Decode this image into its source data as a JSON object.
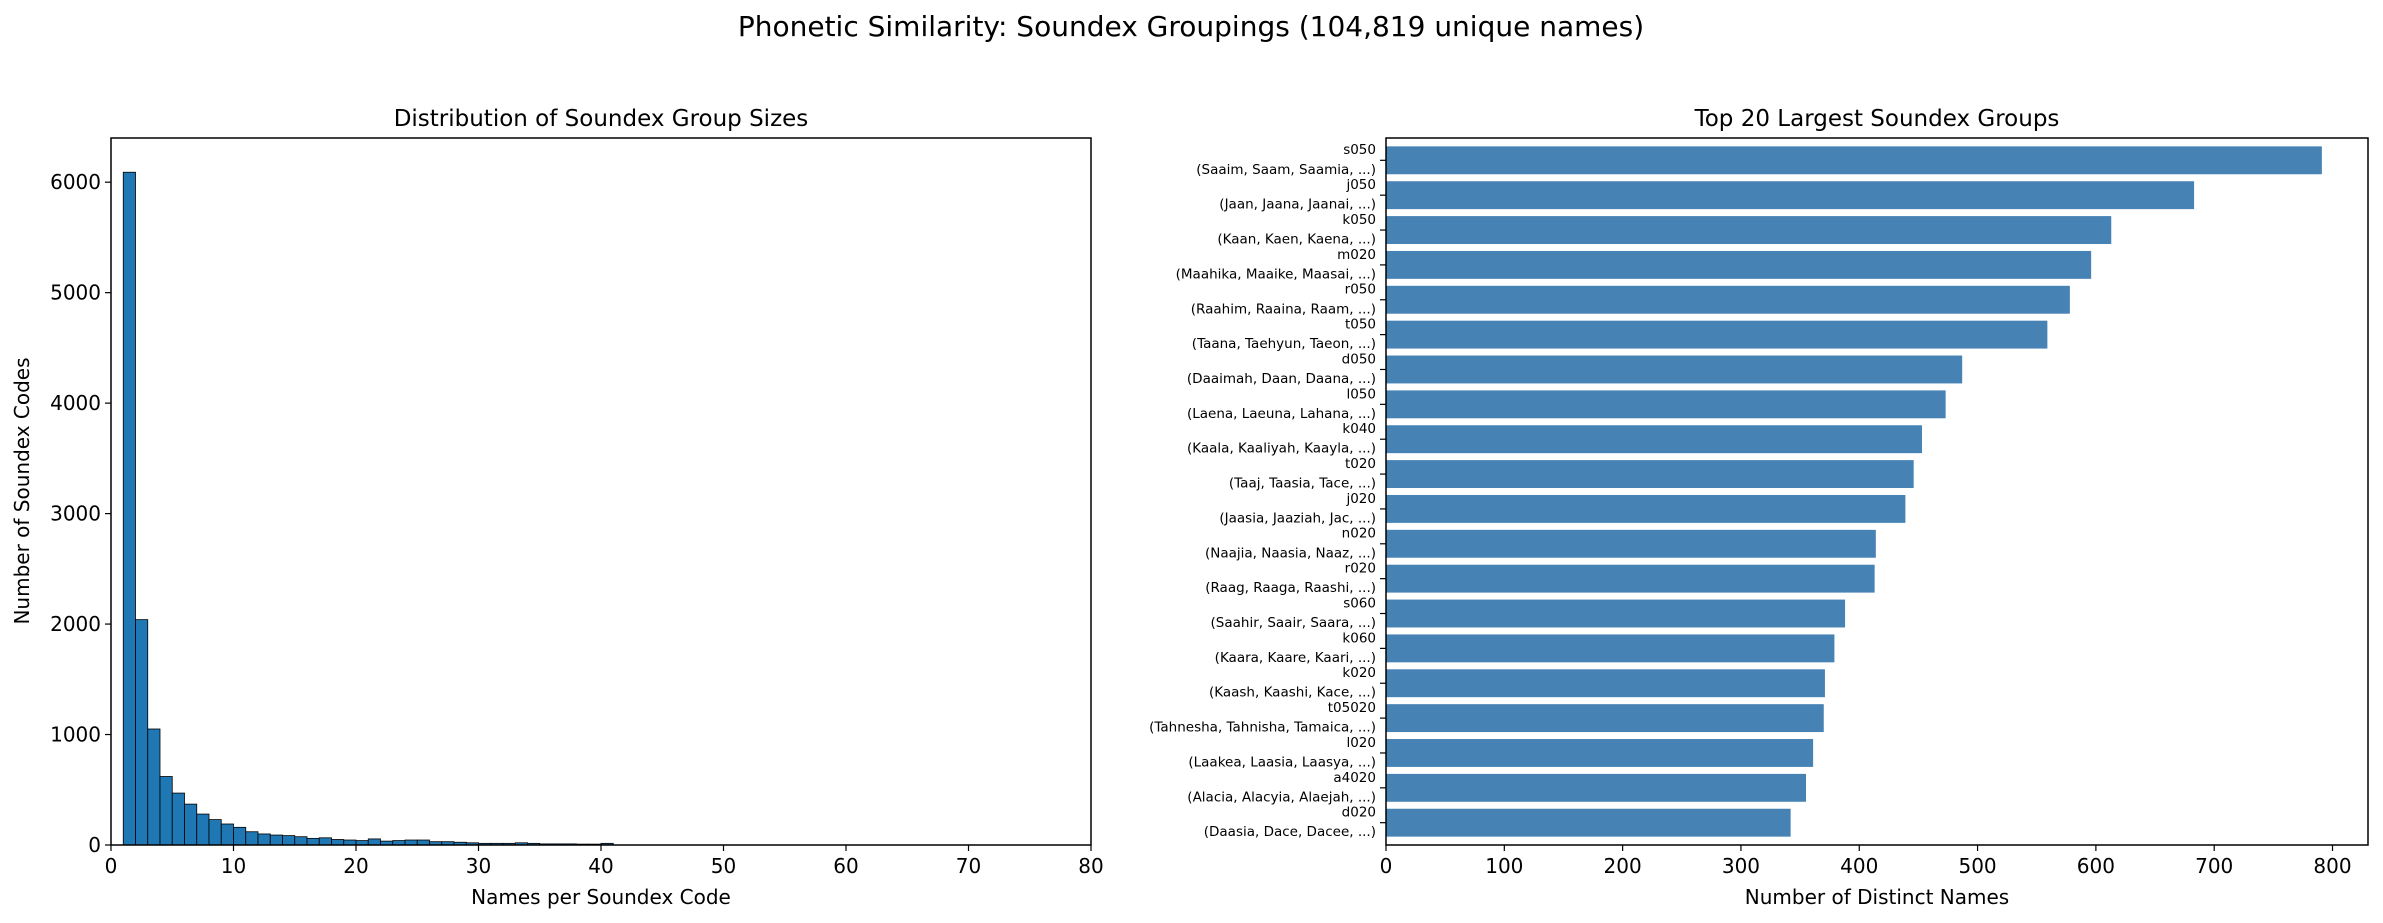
{
  "figure": {
    "suptitle": "Phonetic Similarity: Soundex Groupings (104,819 unique names)"
  },
  "chart_data": [
    {
      "type": "bar",
      "title": "Distribution of Soundex Group Sizes",
      "xlabel": "Names per Soundex Code",
      "ylabel": "Number of Soundex Codes",
      "xlim": [
        0,
        80
      ],
      "ylim": [
        0,
        6400
      ],
      "xticks": [
        0,
        10,
        20,
        30,
        40,
        50,
        60,
        70,
        80
      ],
      "yticks": [
        0,
        1000,
        2000,
        3000,
        4000,
        5000,
        6000
      ],
      "bin_width": 1,
      "grid": false,
      "bar_color": "#1f77b4",
      "edge_color": "#000000",
      "bins_start": [
        1,
        2,
        3,
        4,
        5,
        6,
        7,
        8,
        9,
        10,
        11,
        12,
        13,
        14,
        15,
        16,
        17,
        18,
        19,
        20,
        21,
        22,
        23,
        24,
        25,
        26,
        27,
        28,
        29,
        30,
        31,
        32,
        33,
        34,
        35,
        36,
        37,
        38,
        39,
        40
      ],
      "values": [
        6090,
        2040,
        1050,
        620,
        470,
        370,
        280,
        230,
        190,
        160,
        120,
        100,
        90,
        85,
        75,
        60,
        65,
        50,
        45,
        40,
        55,
        35,
        40,
        45,
        45,
        30,
        30,
        25,
        20,
        15,
        15,
        15,
        20,
        15,
        10,
        10,
        10,
        8,
        8,
        15
      ]
    },
    {
      "type": "bar",
      "orientation": "horizontal",
      "title": "Top 20 Largest Soundex Groups",
      "xlabel": "Number of Distinct Names",
      "xlim": [
        0,
        830
      ],
      "xticks": [
        0,
        100,
        200,
        300,
        400,
        500,
        600,
        700,
        800
      ],
      "grid": false,
      "bar_color": "#4682b4",
      "categories": [
        {
          "code": "s050",
          "examples": "(Saaim, Saam, Saamia, ...)"
        },
        {
          "code": "j050",
          "examples": "(Jaan, Jaana, Jaanai, ...)"
        },
        {
          "code": "k050",
          "examples": "(Kaan, Kaen, Kaena, ...)"
        },
        {
          "code": "m020",
          "examples": "(Maahika, Maaike, Maasai, ...)"
        },
        {
          "code": "r050",
          "examples": "(Raahim, Raaina, Raam, ...)"
        },
        {
          "code": "t050",
          "examples": "(Taana, Taehyun, Taeon, ...)"
        },
        {
          "code": "d050",
          "examples": "(Daaimah, Daan, Daana, ...)"
        },
        {
          "code": "l050",
          "examples": "(Laena, Laeuna, Lahana, ...)"
        },
        {
          "code": "k040",
          "examples": "(Kaala, Kaaliyah, Kaayla, ...)"
        },
        {
          "code": "t020",
          "examples": "(Taaj, Taasia, Tace, ...)"
        },
        {
          "code": "j020",
          "examples": "(Jaasia, Jaaziah, Jac, ...)"
        },
        {
          "code": "n020",
          "examples": "(Naajia, Naasia, Naaz, ...)"
        },
        {
          "code": "r020",
          "examples": "(Raag, Raaga, Raashi, ...)"
        },
        {
          "code": "s060",
          "examples": "(Saahir, Saair, Saara, ...)"
        },
        {
          "code": "k060",
          "examples": "(Kaara, Kaare, Kaari, ...)"
        },
        {
          "code": "k020",
          "examples": "(Kaash, Kaashi, Kace, ...)"
        },
        {
          "code": "t05020",
          "examples": "(Tahnesha, Tahnisha, Tamaica, ...)"
        },
        {
          "code": "l020",
          "examples": "(Laakea, Laasia, Laasya, ...)"
        },
        {
          "code": "a4020",
          "examples": "(Alacia, Alacyia, Alaejah, ...)"
        },
        {
          "code": "d020",
          "examples": "(Daasia, Dace, Dacee, ...)"
        }
      ],
      "values": [
        791,
        683,
        613,
        596,
        578,
        559,
        487,
        473,
        453,
        446,
        439,
        414,
        413,
        388,
        379,
        371,
        370,
        361,
        355,
        342
      ]
    }
  ]
}
